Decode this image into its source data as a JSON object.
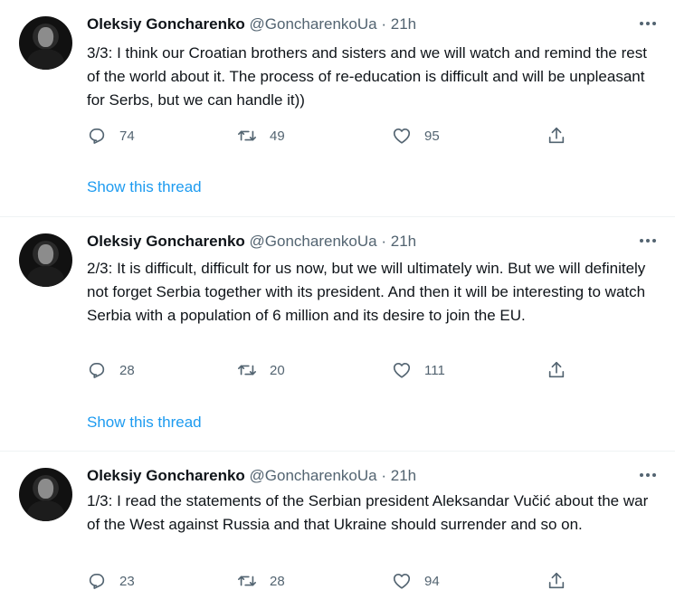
{
  "tweets": [
    {
      "name": "Oleksiy Goncharenko",
      "handle": "@GoncharenkoUa",
      "dot": "·",
      "time": "21h",
      "text": "3/3: I think our Croatian brothers and sisters and we will watch and remind the rest of the world about it. The process of re-education is difficult and will be unpleasant for Serbs, but we can handle it))",
      "replies": "74",
      "retweets": "49",
      "likes": "95",
      "show_thread": "Show this thread"
    },
    {
      "name": "Oleksiy Goncharenko",
      "handle": "@GoncharenkoUa",
      "dot": "·",
      "time": "21h",
      "text": "2/3: It is difficult, difficult for us now, but we will ultimately win. But we will definitely not forget Serbia together with its president. And then it will be interesting to watch Serbia with a population of 6 million and its desire to join the EU.",
      "replies": "28",
      "retweets": "20",
      "likes": "111",
      "show_thread": "Show this thread"
    },
    {
      "name": "Oleksiy Goncharenko",
      "handle": "@GoncharenkoUa",
      "dot": "·",
      "time": "21h",
      "text": "1/3: I read the statements of the Serbian president Aleksandar Vučić about the war of the West against Russia and that Ukraine should surrender and so on.",
      "replies": "23",
      "retweets": "28",
      "likes": "94"
    }
  ],
  "icons": {
    "reply": "reply-icon",
    "retweet": "retweet-icon",
    "like": "like-icon",
    "share": "share-icon",
    "more": "more-icon"
  },
  "colors": {
    "link": "#1d9bf0",
    "secondary_text": "#536471",
    "primary_text": "#0f1419",
    "divider": "#eff3f4"
  }
}
